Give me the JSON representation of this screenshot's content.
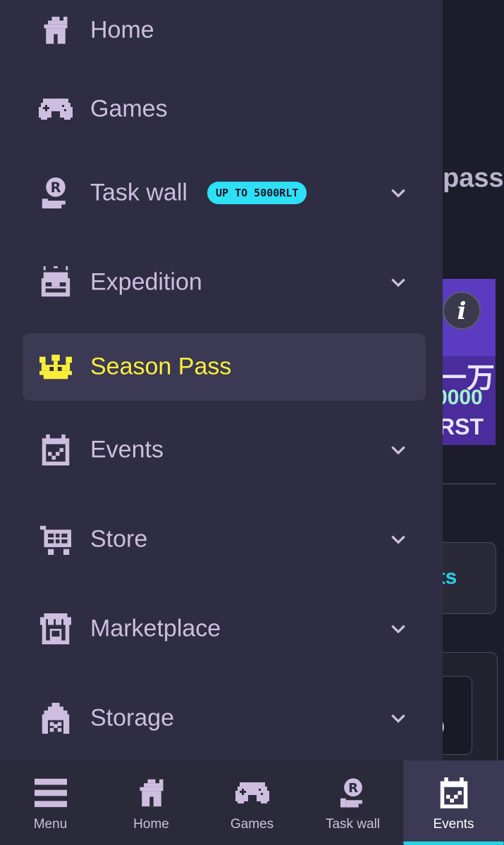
{
  "background": {
    "heading_fragment": "pass",
    "banner_line1": "一万",
    "banner_line2": "0000",
    "banner_line3": "RST",
    "info_label": "i",
    "button_fragment": "sts",
    "card_value": "0"
  },
  "drawer": {
    "items": [
      {
        "label": "Home",
        "icon": "home-icon",
        "chevron": false
      },
      {
        "label": "Games",
        "icon": "gamepad-icon",
        "chevron": false
      },
      {
        "label": "Task wall",
        "icon": "task-wall-icon",
        "chevron": true,
        "badge": "UP TO 5000RLT"
      },
      {
        "label": "Expedition",
        "icon": "treasure-chest-icon",
        "chevron": true
      },
      {
        "label": "Season Pass",
        "icon": "crown-icon",
        "chevron": false,
        "active": true
      },
      {
        "label": "Events",
        "icon": "calendar-check-icon",
        "chevron": true
      },
      {
        "label": "Store",
        "icon": "cart-icon",
        "chevron": true
      },
      {
        "label": "Marketplace",
        "icon": "shop-icon",
        "chevron": true
      },
      {
        "label": "Storage",
        "icon": "warehouse-icon",
        "chevron": true
      }
    ]
  },
  "bottom_nav": {
    "tabs": [
      {
        "label": "Menu",
        "icon": "menu-icon"
      },
      {
        "label": "Home",
        "icon": "home-icon"
      },
      {
        "label": "Games",
        "icon": "gamepad-icon"
      },
      {
        "label": "Task wall",
        "icon": "task-wall-icon"
      },
      {
        "label": "Events",
        "icon": "calendar-check-icon",
        "active": true
      }
    ]
  },
  "colors": {
    "drawer_bg": "#2e2d43",
    "active_bg": "#3b3953",
    "label": "#cdbedf",
    "active_label": "#f9ef3a",
    "badge_bg": "#2ee0f5",
    "accent": "#22d3e6"
  }
}
